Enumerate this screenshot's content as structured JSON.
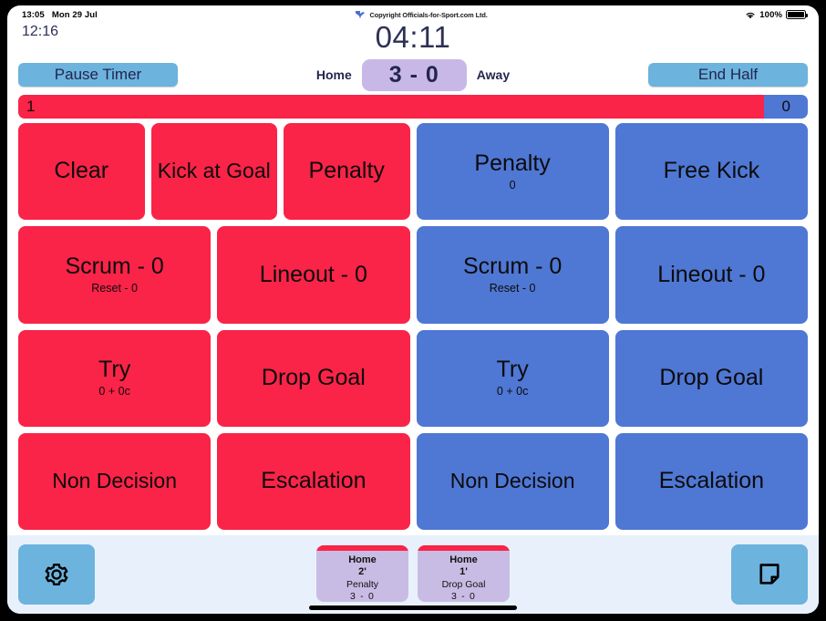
{
  "status_bar": {
    "time": "13:05",
    "date": "Mon 29 Jul",
    "copyright": "Copyright Officials-for-Sport.com Ltd.",
    "battery_percent": "100%",
    "wifi_icon": "wifi-icon",
    "battery_icon": "battery-icon",
    "logo_icon": "brand-logo-icon"
  },
  "header": {
    "half_clock": "12:16",
    "match_timer": "04:11",
    "pause_button": "Pause Timer",
    "end_half_button": "End Half",
    "home_label": "Home",
    "away_label": "Away",
    "score": "3 - 0"
  },
  "possession": {
    "home_value": "1",
    "away_value": "0",
    "home_percent": 94.5,
    "away_percent": 5.5,
    "home_color": "#fa2348",
    "away_color": "#4f77d4"
  },
  "grid": {
    "rows": [
      {
        "home": [
          {
            "label": "Clear",
            "sub": ""
          },
          {
            "label": "Kick at Goal",
            "sub": ""
          },
          {
            "label": "Penalty",
            "sub": ""
          }
        ],
        "away": [
          {
            "label": "Penalty",
            "sub": "0"
          },
          {
            "label": "Free Kick",
            "sub": ""
          }
        ]
      },
      {
        "home": [
          {
            "label": "Scrum - 0",
            "sub": "Reset - 0"
          },
          {
            "label": "Lineout - 0",
            "sub": ""
          }
        ],
        "away": [
          {
            "label": "Scrum - 0",
            "sub": "Reset - 0"
          },
          {
            "label": "Lineout - 0",
            "sub": ""
          }
        ]
      },
      {
        "home": [
          {
            "label": "Try",
            "sub": "0 + 0c"
          },
          {
            "label": "Drop Goal",
            "sub": ""
          }
        ],
        "away": [
          {
            "label": "Try",
            "sub": "0 + 0c"
          },
          {
            "label": "Drop Goal",
            "sub": ""
          }
        ]
      },
      {
        "home": [
          {
            "label": "Non Decision",
            "sub": ""
          },
          {
            "label": "Escalation",
            "sub": ""
          }
        ],
        "away": [
          {
            "label": "Non Decision",
            "sub": ""
          },
          {
            "label": "Escalation",
            "sub": ""
          }
        ]
      }
    ]
  },
  "footer": {
    "settings_icon": "gear-icon",
    "notes_icon": "note-icon",
    "events": [
      {
        "team": "Home",
        "minute": "2'",
        "kind": "Penalty",
        "score": "3 - 0"
      },
      {
        "team": "Home",
        "minute": "1'",
        "kind": "Drop Goal",
        "score": "3 - 0"
      }
    ]
  }
}
